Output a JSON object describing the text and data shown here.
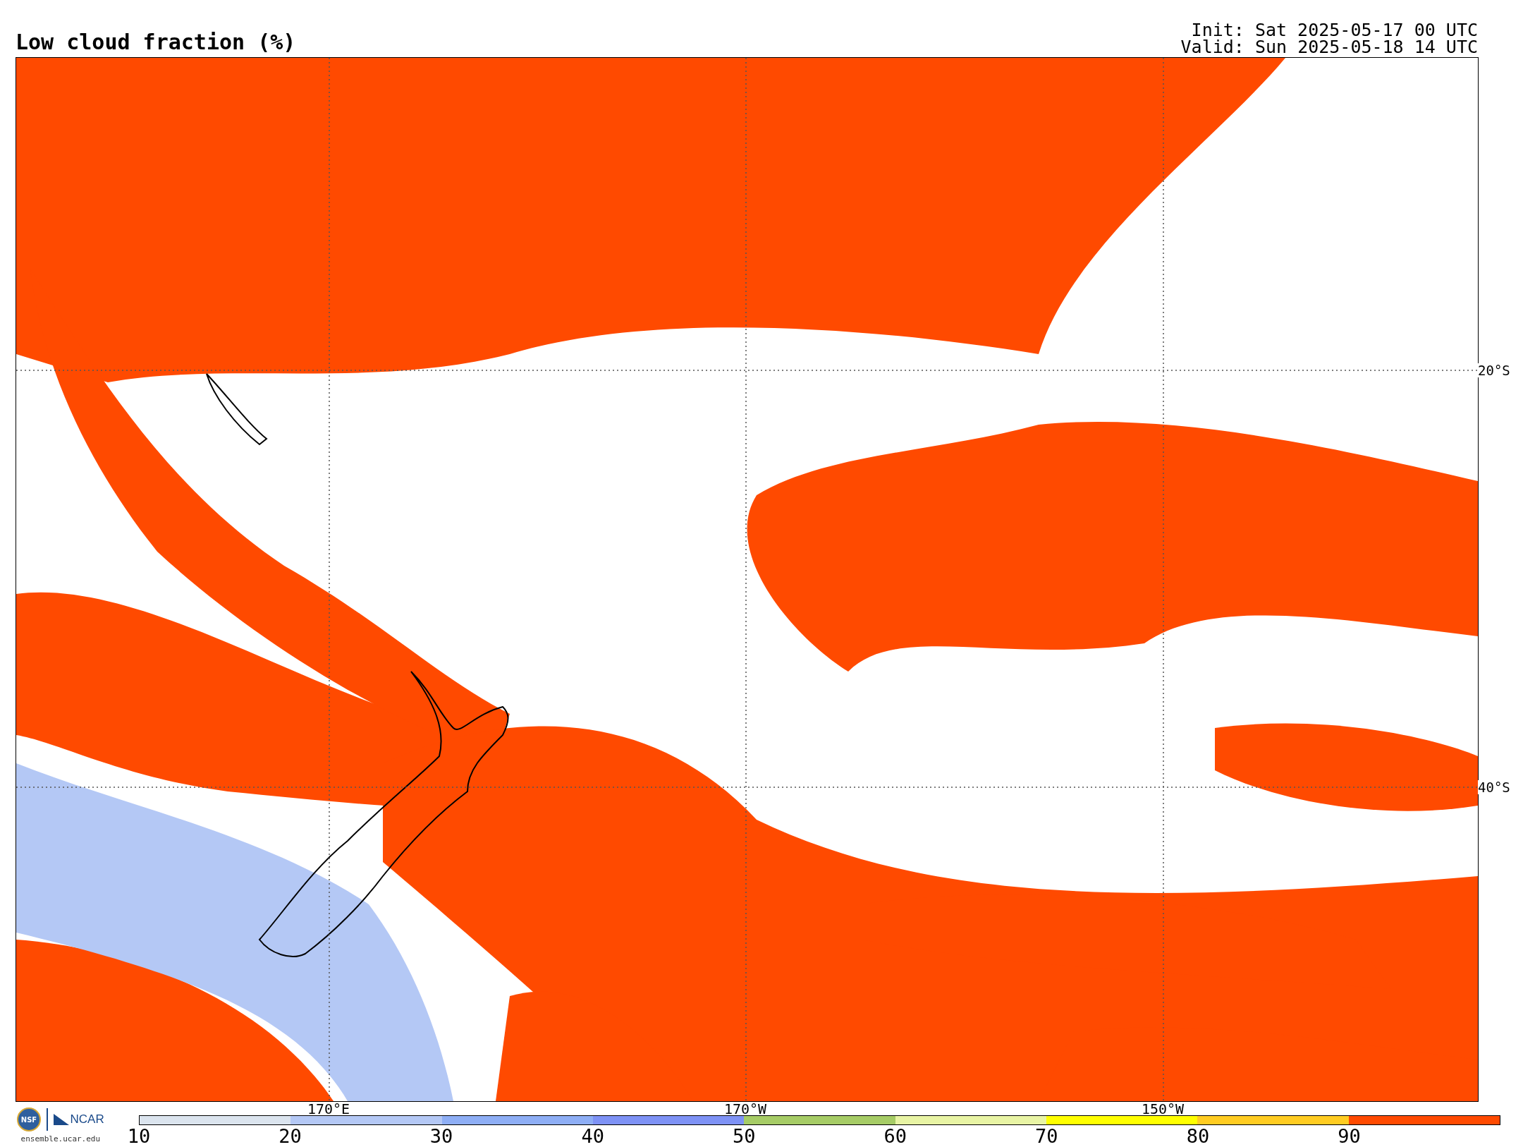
{
  "title": "Low cloud fraction (%)",
  "init": "Init: Sat 2025-05-17 00 UTC",
  "valid": "Valid: Sun 2025-05-18 14 UTC",
  "map": {
    "latitude_labels": [
      "20°S",
      "40°S"
    ],
    "longitude_labels": [
      "170°E",
      "170°W",
      "150°W"
    ]
  },
  "logos": {
    "nsf": "NSF",
    "ncar": "NCAR",
    "site": "ensemble.ucar.edu"
  },
  "colorbar": {
    "segments": [
      {
        "label": "10",
        "color": "#dbe4ee"
      },
      {
        "label": "20",
        "color": "#b4c8f5"
      },
      {
        "label": "30",
        "color": "#8eaef5"
      },
      {
        "label": "40",
        "color": "#7e92f5"
      },
      {
        "label": "50",
        "color": "#a6cc66"
      },
      {
        "label": "60",
        "color": "#e8f4a4"
      },
      {
        "label": "70",
        "color": "#ffff00"
      },
      {
        "label": "80",
        "color": "#ffcc22"
      },
      {
        "label": "90",
        "color": "#ff4a00"
      }
    ]
  }
}
